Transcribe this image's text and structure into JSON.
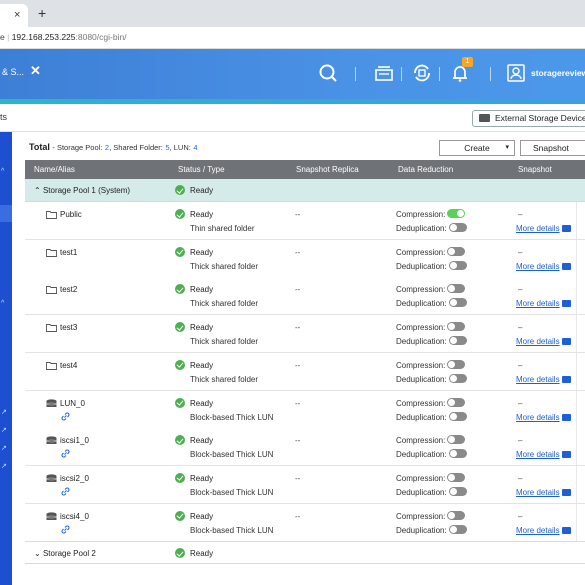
{
  "browser": {
    "tab_close": "×",
    "new_tab": "+",
    "url_prefix": "e",
    "url_host": "192.168.253.225",
    "url_rest": ":8080/cgi-bin/"
  },
  "app": {
    "title": "& S...",
    "close": "✕",
    "notification_count": "1",
    "user": "storagereview",
    "accent": "#4a92e6"
  },
  "subheader": {
    "title": "ts",
    "external_button": "External Storage Device"
  },
  "summary": {
    "total_label": "Total",
    "storage_pool_label": "Storage Pool:",
    "storage_pool_count": "2",
    "shared_folder_label": "Shared Folder:",
    "shared_folder_count": "5",
    "lun_label": "LUN:",
    "lun_count": "4"
  },
  "toolbar": {
    "create": "Create",
    "snapshot": "Snapshot"
  },
  "columns": [
    "Name/Alias",
    "Status / Type",
    "Snapshot Replica",
    "Data Reduction",
    "Snapshot"
  ],
  "pool1": {
    "name": "Storage Pool 1 (System)",
    "status": "Ready"
  },
  "rows": [
    {
      "name": "Public",
      "kind": "folder",
      "status": "Ready",
      "type": "Thin shared folder",
      "replica": "--",
      "compression_label": "Compression:",
      "compression_on": true,
      "dedup_label": "Deduplication:",
      "snapshot": "–",
      "more": "More details"
    },
    {
      "name": "test1",
      "kind": "folder",
      "status": "Ready",
      "type": "Thick shared folder",
      "replica": "--",
      "compression_label": "Compression:",
      "compression_on": false,
      "dedup_label": "Deduplication:",
      "snapshot": "–",
      "more": "More details"
    },
    {
      "name": "test2",
      "kind": "folder",
      "status": "Ready",
      "type": "Thick shared folder",
      "replica": "--",
      "compression_label": "Compression:",
      "compression_on": false,
      "dedup_label": "Deduplication:",
      "snapshot": "–",
      "more": "More details"
    },
    {
      "name": "test3",
      "kind": "folder",
      "status": "Ready",
      "type": "Thick shared folder",
      "replica": "--",
      "compression_label": "Compression:",
      "compression_on": false,
      "dedup_label": "Deduplication:",
      "snapshot": "–",
      "more": "More details"
    },
    {
      "name": "test4",
      "kind": "folder",
      "status": "Ready",
      "type": "Thick shared folder",
      "replica": "--",
      "compression_label": "Compression:",
      "compression_on": false,
      "dedup_label": "Deduplication:",
      "snapshot": "–",
      "more": "More details"
    },
    {
      "name": "LUN_0",
      "kind": "lun",
      "status": "Ready",
      "type": "Block-based Thick LUN",
      "replica": "--",
      "compression_label": "Compression:",
      "compression_on": false,
      "dedup_label": "Deduplication:",
      "snapshot": "–",
      "more": "More details"
    },
    {
      "name": "iscsi1_0",
      "kind": "lun",
      "status": "Ready",
      "type": "Block-based Thick LUN",
      "replica": "--",
      "compression_label": "Compression:",
      "compression_on": false,
      "dedup_label": "Deduplication:",
      "snapshot": "–",
      "more": "More details"
    },
    {
      "name": "iscsi2_0",
      "kind": "lun",
      "status": "Ready",
      "type": "Block-based Thick LUN",
      "replica": "--",
      "compression_label": "Compression:",
      "compression_on": false,
      "dedup_label": "Deduplication:",
      "snapshot": "–",
      "more": "More details"
    },
    {
      "name": "iscsi4_0",
      "kind": "lun",
      "status": "Ready",
      "type": "Block-based Thick LUN",
      "replica": "--",
      "compression_label": "Compression:",
      "compression_on": false,
      "dedup_label": "Deduplication:",
      "snapshot": "–",
      "more": "More details"
    }
  ],
  "pool2": {
    "name": "Storage Pool 2",
    "status": "Ready"
  }
}
